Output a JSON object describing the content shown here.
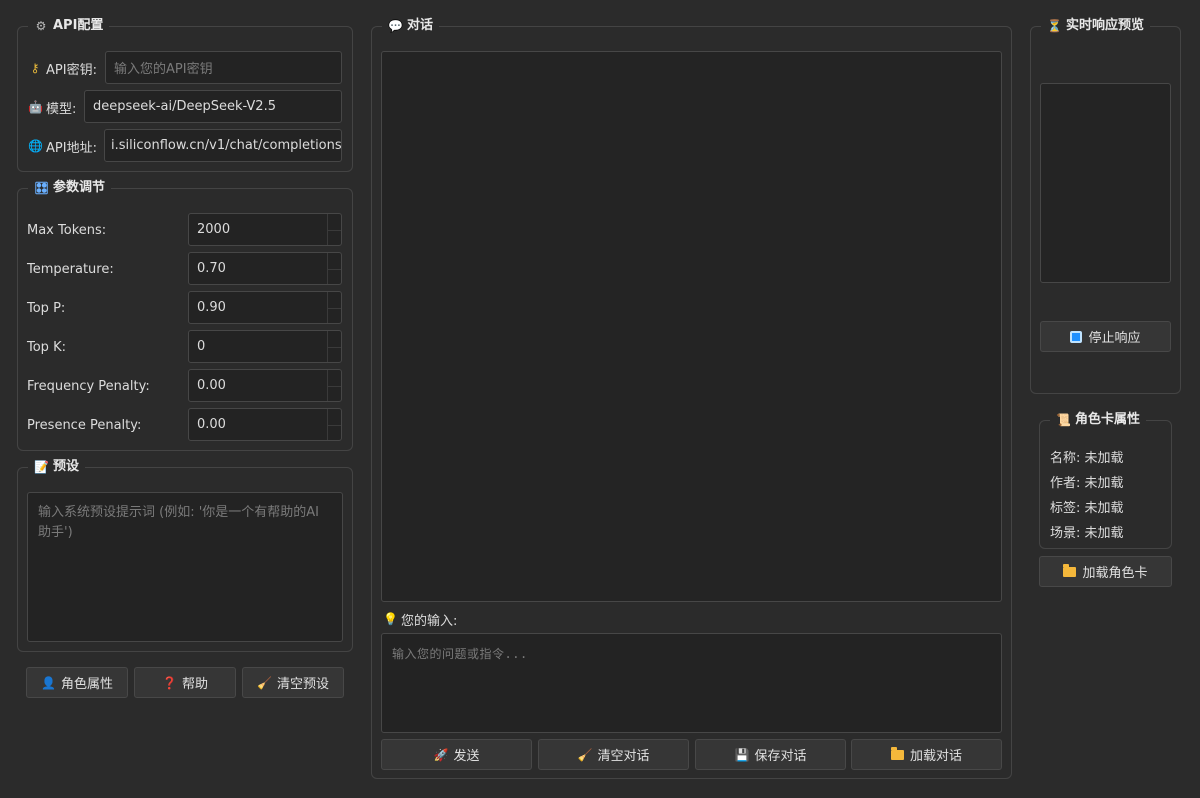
{
  "api_config": {
    "title": "API配置",
    "key_label": "API密钥:",
    "key_placeholder": "输入您的API密钥",
    "model_label": "模型:",
    "model_value": "deepseek-ai/DeepSeek-V2.5",
    "url_label": "API地址:",
    "url_value": "i.siliconflow.cn/v1/chat/completions"
  },
  "params": {
    "title": "参数调节",
    "rows": [
      {
        "label": "Max Tokens:",
        "value": "2000"
      },
      {
        "label": "Temperature:",
        "value": "0.70"
      },
      {
        "label": "Top P:",
        "value": "0.90"
      },
      {
        "label": "Top K:",
        "value": "0"
      },
      {
        "label": "Frequency Penalty:",
        "value": "0.00"
      },
      {
        "label": "Presence Penalty:",
        "value": "0.00"
      }
    ]
  },
  "preset": {
    "title": "预设",
    "placeholder": "输入系统预设提示词 (例如: '你是一个有帮助的AI助手')"
  },
  "left_buttons": {
    "role": "角色属性",
    "help": "帮助",
    "clear_preset": "清空预设"
  },
  "chat": {
    "title": "对话",
    "input_label": "您的输入:",
    "input_placeholder": "输入您的问题或指令...",
    "send": "发送",
    "clear": "清空对话",
    "save": "保存对话",
    "load": "加载对话"
  },
  "preview": {
    "title": "实时响应预览",
    "stop": "停止响应"
  },
  "card": {
    "title": "角色卡属性",
    "name": "名称: 未加载",
    "author": "作者: 未加载",
    "tags": "标签: 未加载",
    "scene": "场景: 未加载",
    "load": "加载角色卡"
  }
}
